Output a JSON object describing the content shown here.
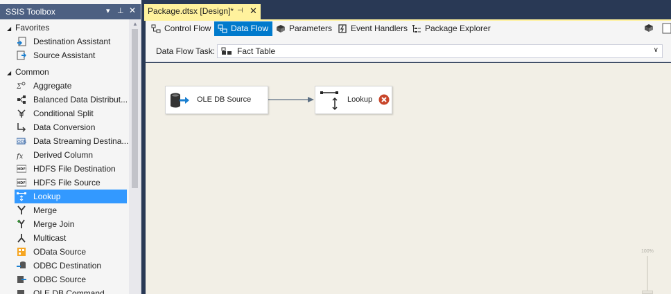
{
  "toolbox": {
    "title": "SSIS Toolbox",
    "groups": [
      {
        "label": "Favorites",
        "items": [
          "Destination Assistant",
          "Source Assistant"
        ]
      },
      {
        "label": "Common",
        "items": [
          "Aggregate",
          "Balanced Data Distribut...",
          "Conditional Split",
          "Data Conversion",
          "Data Streaming Destina...",
          "Derived Column",
          "HDFS File Destination",
          "HDFS File Source",
          "Lookup",
          "Merge",
          "Merge Join",
          "Multicast",
          "OData Source",
          "ODBC Destination",
          "ODBC Source",
          "OLE DB Command"
        ]
      }
    ],
    "selected_item": "Lookup"
  },
  "document": {
    "tab_title": "Package.dtsx [Design]*"
  },
  "designer_tabs": [
    "Control Flow",
    "Data Flow",
    "Parameters",
    "Event Handlers",
    "Package Explorer"
  ],
  "active_designer_tab": "Data Flow",
  "task": {
    "label": "Data Flow Task:",
    "value": "Fact Table"
  },
  "canvas": {
    "components": [
      {
        "name": "OLE DB Source"
      },
      {
        "name": "Lookup",
        "status": "error"
      }
    ],
    "zoom_label": "100%"
  },
  "colors": {
    "accent": "#007acc",
    "selected": "#3399ff",
    "tab_highlight": "#fff29d",
    "error": "#c8462a",
    "canvas_bg": "#f2efe6"
  }
}
